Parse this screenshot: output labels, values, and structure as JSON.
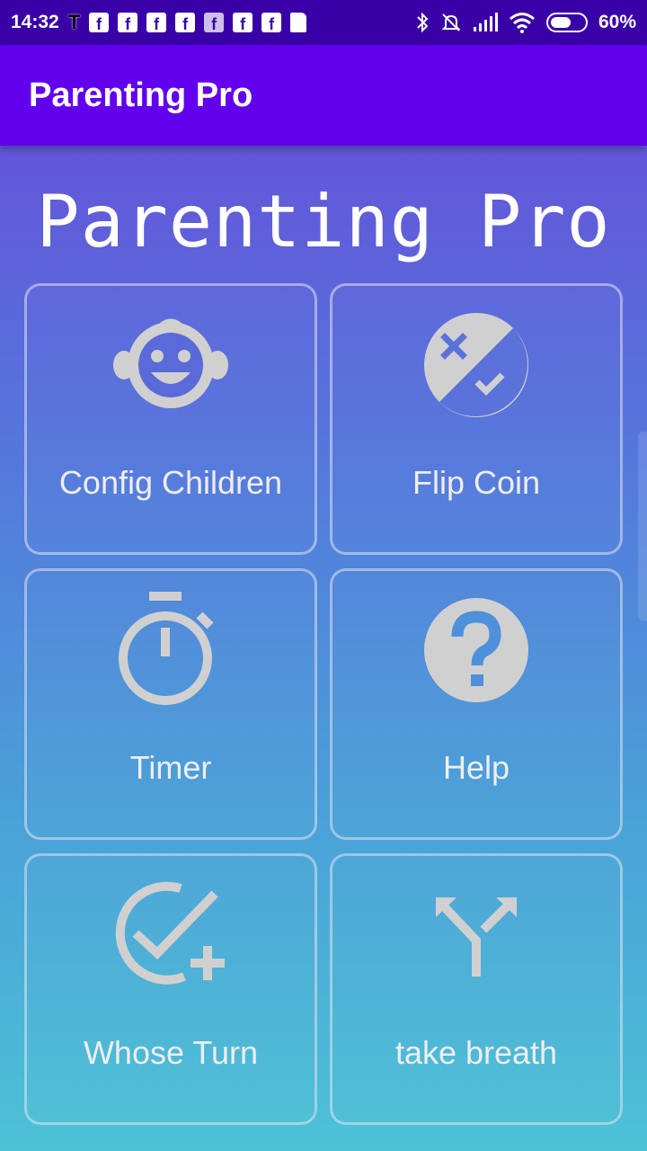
{
  "status_bar": {
    "time": "14:32",
    "notification_icons": [
      "t-icon",
      "facebook-icon",
      "facebook-icon",
      "facebook-icon",
      "facebook-icon",
      "facebook-icon",
      "facebook-icon",
      "facebook-icon",
      "sd-card-icon"
    ],
    "system_icons": [
      "bluetooth-icon",
      "muted-bell-icon",
      "signal-icon",
      "wifi-icon",
      "battery-icon"
    ],
    "battery": "60%"
  },
  "app_bar": {
    "title": "Parenting Pro"
  },
  "main": {
    "heading": "Parenting Pro",
    "tiles": [
      {
        "label": "Config Children",
        "icon": "child-face-icon"
      },
      {
        "label": "Flip Coin",
        "icon": "flip-coin-icon"
      },
      {
        "label": "Timer",
        "icon": "stopwatch-icon"
      },
      {
        "label": "Help",
        "icon": "help-question-icon"
      },
      {
        "label": "Whose Turn",
        "icon": "check-add-icon"
      },
      {
        "label": "take breath",
        "icon": "fork-arrows-icon"
      }
    ]
  },
  "colors": {
    "app_bar": "#6200ee",
    "status_bar": "#3a00a8",
    "gradient_top": "#6a46d8",
    "gradient_bottom": "#4cc2d6",
    "icon": "#d0d0d0"
  }
}
